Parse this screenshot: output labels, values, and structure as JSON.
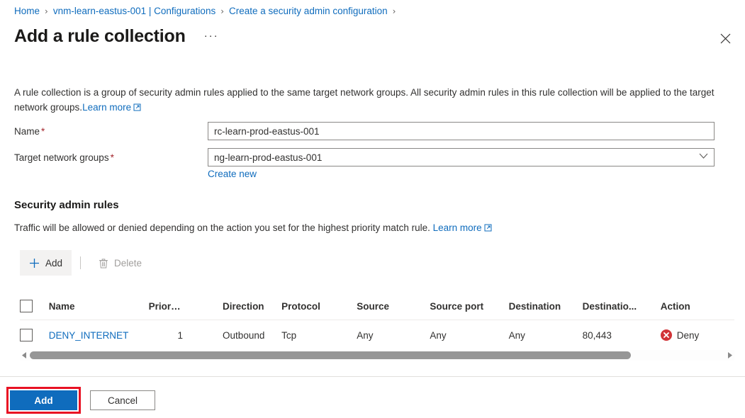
{
  "breadcrumb": {
    "items": [
      {
        "label": "Home",
        "link": true
      },
      {
        "label": "vnm-learn-eastus-001 | Configurations",
        "link": true
      },
      {
        "label": "Create a security admin configuration",
        "link": true
      }
    ],
    "separator": "›"
  },
  "header": {
    "title": "Add a rule collection",
    "more_dots": "···",
    "close_icon": "close-icon"
  },
  "description": {
    "text": "A rule collection is a group of security admin rules applied to the same target network groups. All security admin rules in this rule collection will be applied to the target network groups.",
    "learn_more": "Learn more"
  },
  "form": {
    "name": {
      "label": "Name",
      "required": "*",
      "value": "rc-learn-prod-eastus-001",
      "placeholder": ""
    },
    "target_network_groups": {
      "label": "Target network groups",
      "required": "*",
      "value": "ng-learn-prod-eastus-001",
      "placeholder": "",
      "create_new": "Create new",
      "chevron_icon": "chevron-down-icon"
    }
  },
  "security_admin_rules": {
    "heading": "Security admin rules",
    "subtext": "Traffic will be allowed or denied depending on the action you set for the highest priority match rule.",
    "learn_more": "Learn more",
    "toolbar": {
      "add_label": "Add",
      "add_icon": "plus-icon",
      "delete_label": "Delete",
      "delete_icon": "trash-icon",
      "delete_disabled": true
    },
    "table": {
      "columns": [
        {
          "key": "check",
          "label": ""
        },
        {
          "key": "name",
          "label": "Name"
        },
        {
          "key": "priority",
          "label": "Priority",
          "sort": "↑"
        },
        {
          "key": "direction",
          "label": "Direction"
        },
        {
          "key": "protocol",
          "label": "Protocol"
        },
        {
          "key": "source",
          "label": "Source"
        },
        {
          "key": "source_port",
          "label": "Source port"
        },
        {
          "key": "destination",
          "label": "Destination"
        },
        {
          "key": "destination_port",
          "label": "Destinatio..."
        },
        {
          "key": "action",
          "label": "Action"
        }
      ],
      "rows": [
        {
          "name": "DENY_INTERNET",
          "priority": "1",
          "direction": "Outbound",
          "protocol": "Tcp",
          "source": "Any",
          "source_port": "Any",
          "destination": "Any",
          "destination_port": "80,443",
          "action": "Deny",
          "action_icon": "deny-circle-x-icon"
        }
      ]
    },
    "scrollbar": {
      "left_arrow": "◀",
      "right_arrow": "▶",
      "thumb_percent": 86.5
    }
  },
  "footer": {
    "add_label": "Add",
    "cancel_label": "Cancel",
    "highlight_color": "#e81123"
  },
  "colors": {
    "accent": "#0f6cbd",
    "required": "#a4262c",
    "deny": "#d13438",
    "text": "#323130",
    "border": "#8a8886"
  }
}
